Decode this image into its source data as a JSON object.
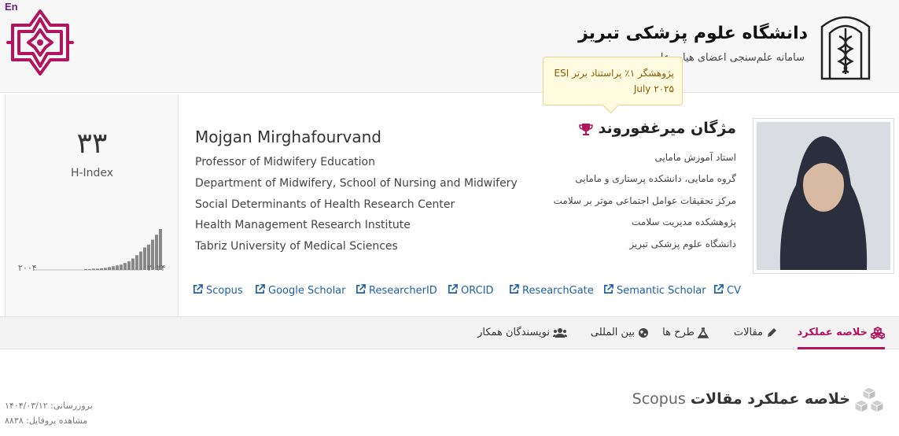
{
  "header": {
    "lang_switch": "En",
    "title": "دانشگاه علوم پزشکی تبریز",
    "subtitle": "سامانه علم‌سنجی اعضای هیات علمی"
  },
  "hindex": {
    "value": "۳۳",
    "label": "H-Index",
    "year_start": "۲۰۰۴",
    "year_end": "۲۰۲۴",
    "bars": [
      0.02,
      0.02,
      0.03,
      0.03,
      0.04,
      0.05,
      0.07,
      0.09,
      0.11,
      0.13,
      0.17,
      0.21,
      0.28,
      0.36,
      0.45,
      0.55,
      0.62,
      0.74,
      0.86,
      1.0
    ]
  },
  "profile": {
    "name_en": "Mojgan Mirghafourvand",
    "lines_en": [
      "Professor of Midwifery Education",
      "Department of Midwifery, School of Nursing and Midwifery",
      "Social Determinants of Health Research Center",
      "Health Management Research Institute",
      "Tabriz University of Medical Sciences"
    ],
    "name_fa": "مژگان میرغفوروند",
    "lines_fa": [
      "استاد آموزش مامایی",
      "گروه مامایی، دانشکده پرستاری و مامایی",
      "مرکز تحقیقات عوامل اجتماعی موثر بر سلامت",
      "پژوهشکده مدیریت سلامت",
      "دانشگاه علوم پزشکی تبریز"
    ]
  },
  "tooltip": {
    "line1": "پژوهشگر ۱٪ پراستناد برتر ESI",
    "line2": "July ۲۰۲۵"
  },
  "links": [
    {
      "label": "Scopus"
    },
    {
      "label": "Google Scholar"
    },
    {
      "label": "ResearcherID"
    },
    {
      "label": "ORCID"
    },
    {
      "label": "ResearchGate"
    },
    {
      "label": "Semantic Scholar"
    },
    {
      "label": "CV"
    }
  ],
  "tabs": [
    {
      "label": "خلاصه عملکرد",
      "icon": "cubes-icon"
    },
    {
      "label": "مقالات",
      "icon": "pencil-icon"
    },
    {
      "label": "طرح ها",
      "icon": "flask-icon"
    },
    {
      "label": "بین المللی",
      "icon": "globe-icon"
    },
    {
      "label": "نویسندگان همکار",
      "icon": "users-icon"
    }
  ],
  "content": {
    "section_title_main": "خلاصه عملکرد مقالات",
    "section_title_source": "Scopus",
    "updated": "بروزرسانی: ۱۴۰۴/۰۳/۱۲",
    "views": "مشاهده پروفایل: ۸۸۳۸"
  },
  "colors": {
    "accent": "#b0155e",
    "link": "#1f5fa8",
    "tooltip_bg": "#fffbe0"
  }
}
